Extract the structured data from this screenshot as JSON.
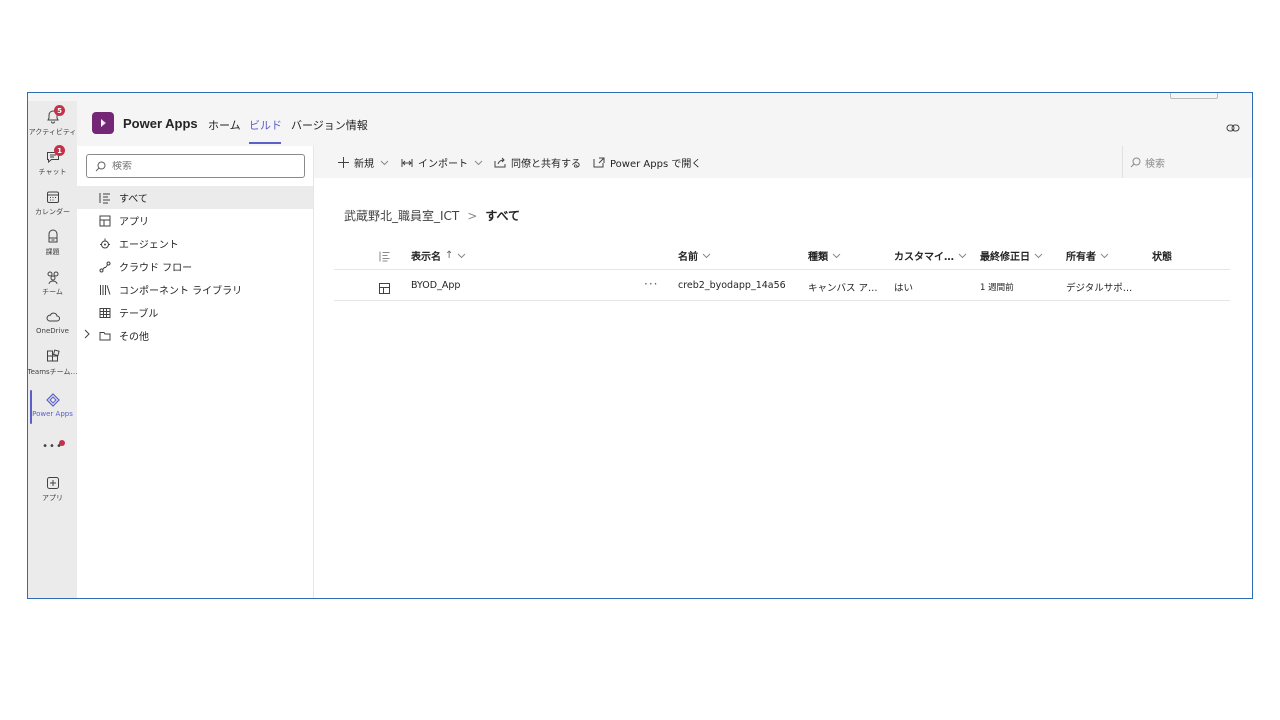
{
  "rail": {
    "items": [
      {
        "label": "アクティビティ",
        "icon": "bell-icon",
        "badge": "5"
      },
      {
        "label": "チャット",
        "icon": "chat-icon",
        "badge": "1"
      },
      {
        "label": "カレンダー",
        "icon": "calendar-icon"
      },
      {
        "label": "課題",
        "icon": "assignments-icon"
      },
      {
        "label": "チーム",
        "icon": "teams-icon"
      },
      {
        "label": "OneDrive",
        "icon": "cloud-icon"
      },
      {
        "label": "Teamsチーム…",
        "icon": "apps-grid-icon"
      },
      {
        "label": "Power Apps",
        "icon": "powerapps-icon",
        "active": true
      },
      {
        "label": "アプリ",
        "icon": "add-app-icon"
      }
    ],
    "more_label": "•••"
  },
  "header": {
    "app_title": "Power Apps",
    "tabs": [
      {
        "label": "ホーム",
        "active": false
      },
      {
        "label": "ビルド",
        "active": true
      },
      {
        "label": "バージョン情報",
        "active": false
      }
    ]
  },
  "leftnav": {
    "search_placeholder": "検索",
    "items": [
      {
        "label": "すべて",
        "icon": "list-icon",
        "selected": true
      },
      {
        "label": "アプリ",
        "icon": "app-icon"
      },
      {
        "label": "エージェント",
        "icon": "agent-icon"
      },
      {
        "label": "クラウド フロー",
        "icon": "flow-icon"
      },
      {
        "label": "コンポーネント ライブラリ",
        "icon": "library-icon"
      },
      {
        "label": "テーブル",
        "icon": "table-icon"
      },
      {
        "label": "その他",
        "icon": "folder-icon",
        "expandable": true
      }
    ]
  },
  "commandbar": {
    "new_label": "新規",
    "import_label": "インポート",
    "share_label": "同僚と共有する",
    "open_label": "Power Apps で開く",
    "search_placeholder": "検索"
  },
  "breadcrumb": {
    "parent": "武蔵野北_職員室_ICT",
    "separator": ">",
    "current": "すべて"
  },
  "grid": {
    "columns": [
      {
        "label": "表示名",
        "sort": "↑"
      },
      {
        "label": "名前"
      },
      {
        "label": "種類"
      },
      {
        "label": "カスタマイ…"
      },
      {
        "label": "最終修正日"
      },
      {
        "label": "所有者"
      },
      {
        "label": "状態"
      }
    ],
    "rows": [
      {
        "display_name": "BYOD_App",
        "more": "···",
        "name": "creb2_byodapp_14a56",
        "type": "キャンバス ア…",
        "customizable": "はい",
        "modified": "1 週間前",
        "owner": "デジタルサポ…",
        "status": ""
      }
    ]
  },
  "colors": {
    "accent": "#5b5fc7",
    "powerapps_brand": "#742774",
    "badge": "#c4314b",
    "frame_border": "#2e6db4"
  }
}
